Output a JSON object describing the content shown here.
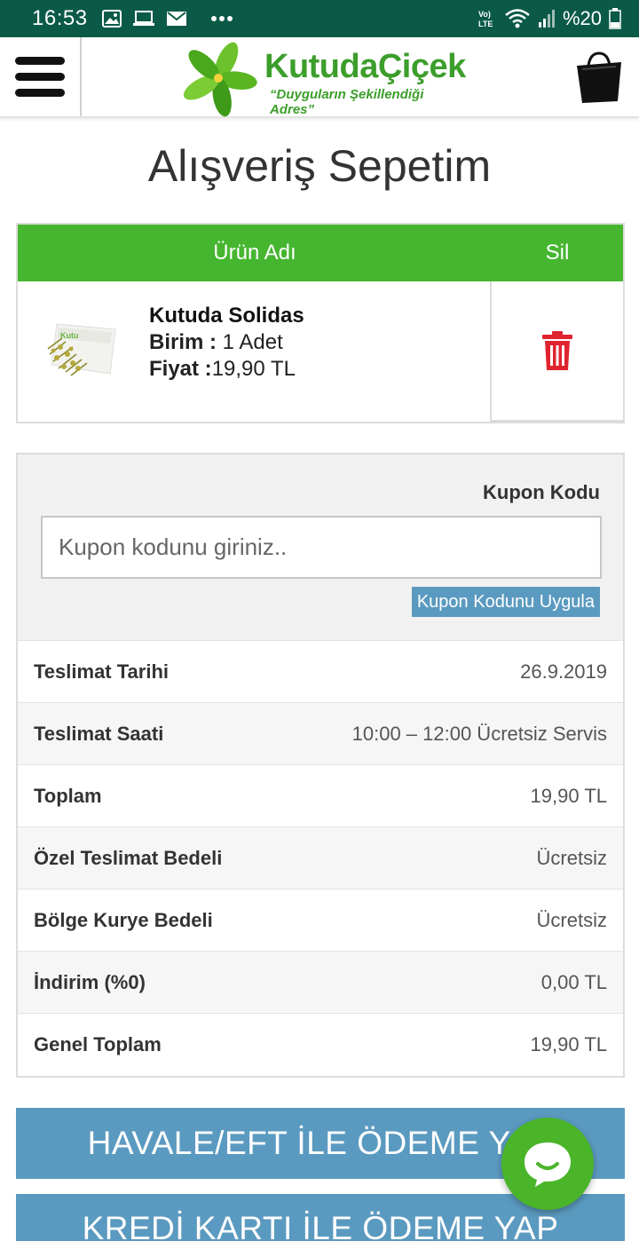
{
  "status_bar": {
    "time": "16:53",
    "network": "Vo) LTE",
    "battery": "%20",
    "icons": [
      "image-icon",
      "laptop-icon",
      "mail-icon",
      "more-icon",
      "volte-icon",
      "wifi-icon",
      "signal-icon",
      "battery-icon"
    ]
  },
  "header": {
    "logo_title": "KutudaÇiçek",
    "logo_subtitle": "“Duyguların Şekillendiği Adres”",
    "menu_icon": "hamburger-menu-icon",
    "cart_icon": "shopping-bag-icon"
  },
  "page": {
    "title": "Alışveriş Sepetim"
  },
  "cart": {
    "headers": {
      "name": "Ürün Adı",
      "delete": "Sil"
    },
    "items": [
      {
        "name": "Kutuda Solidas",
        "unit_label": "Birim :",
        "unit_value": " 1 Adet",
        "price_label": "Fiyat :",
        "price_value": "19,90 TL"
      }
    ]
  },
  "coupon": {
    "label": "Kupon Kodu",
    "placeholder": "Kupon kodunu giriniz..",
    "apply_label": "Kupon Kodunu Uygula"
  },
  "summary": [
    {
      "label": "Teslimat Tarihi",
      "value": "26.9.2019"
    },
    {
      "label": "Teslimat Saati",
      "value": "10:00 – 12:00 Ücretsiz Servis"
    },
    {
      "label": "Toplam",
      "value": "19,90 TL"
    },
    {
      "label": "Özel Teslimat Bedeli",
      "value": "Ücretsiz"
    },
    {
      "label": "Bölge Kurye Bedeli",
      "value": "Ücretsiz"
    },
    {
      "label": "İndirim (%0)",
      "value": "0,00 TL"
    },
    {
      "label": "Genel Toplam",
      "value": "19,90 TL"
    }
  ],
  "payment": {
    "havale_label": "HAVALE/EFT İLE ÖDEME YAP",
    "kredi_label": "KREDİ KARTI İLE ÖDEME YAP"
  },
  "colors": {
    "status_bar": "#0b5a48",
    "brand_green": "#46b630",
    "button_blue": "#5b9ac0",
    "delete_red": "#e0242f"
  }
}
